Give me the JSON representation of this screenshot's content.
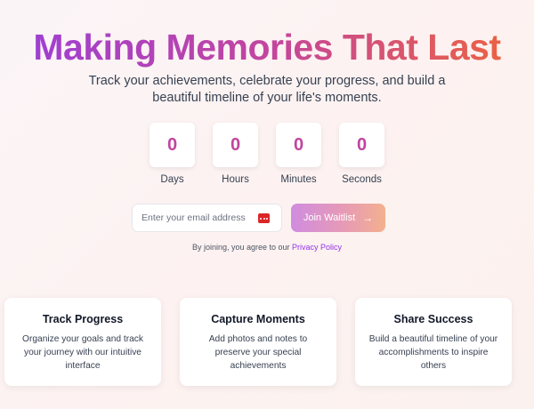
{
  "hero": {
    "title": "Making Memories That Last",
    "subtitle": "Track your achievements, celebrate your progress, and build a beautiful timeline of your life's moments.",
    "gradient_colors": [
      "#9b3fd8",
      "#c2459e",
      "#f0653a"
    ]
  },
  "countdown": [
    {
      "value": "0",
      "label": "Days"
    },
    {
      "value": "0",
      "label": "Hours"
    },
    {
      "value": "0",
      "label": "Minutes"
    },
    {
      "value": "0",
      "label": "Seconds"
    }
  ],
  "signup": {
    "email_placeholder": "Enter your email address",
    "email_value": "",
    "password_manager_icon": "password-manager-icon",
    "join_label": "Join Waitlist",
    "join_icon": "arrow-right-icon"
  },
  "privacy": {
    "prefix": "By joining, you agree to our",
    "link_label": "Privacy Policy",
    "link_color": "#9333ea"
  },
  "features": [
    {
      "title": "Track Progress",
      "description": "Organize your goals and track your journey with our intuitive interface"
    },
    {
      "title": "Capture Moments",
      "description": "Add photos and notes to preserve your special achievements"
    },
    {
      "title": "Share Success",
      "description": "Build a beautiful timeline of your accomplishments to inspire others"
    }
  ]
}
